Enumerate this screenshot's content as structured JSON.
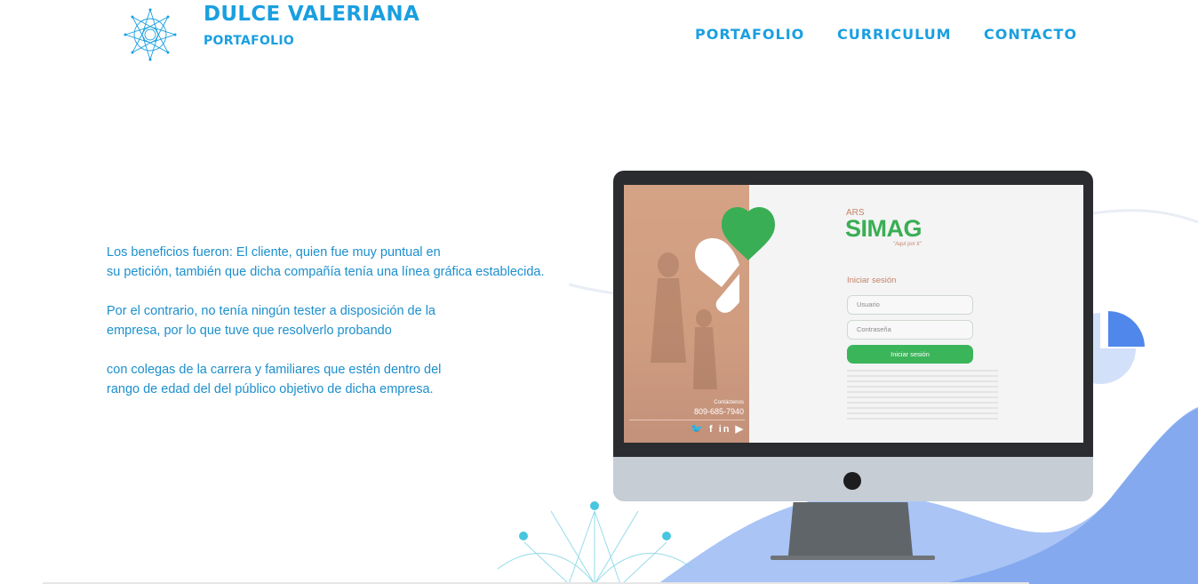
{
  "header": {
    "title": "DULCE VALERIANA",
    "subtitle": "PORTAFOLIO",
    "logo_icon": "mandala-icon"
  },
  "nav": {
    "items": [
      {
        "label": "PORTAFOLIO"
      },
      {
        "label": "CURRICULUM"
      },
      {
        "label": "CONTACTO"
      }
    ]
  },
  "content": {
    "paragraph1_line1": "Los beneficios fueron: El cliente, quien fue muy puntual en",
    "paragraph1_line2": "su petición, también que dicha compañía tenía una línea gráfica establecida.",
    "paragraph2_line1": "Por el contrario, no tenía ningún tester a disposición de la",
    "paragraph2_line2": "empresa, por lo que tuve que resolverlo probando",
    "paragraph3_line1": "con colegas de la carrera y familiares que estén dentro del",
    "paragraph3_line2": "rango de edad del del público objetivo de dicha empresa."
  },
  "mockup": {
    "brand_small": "ARS",
    "brand_name": "SIMAG",
    "slogan": "\"Aquí por ti\"",
    "login_title": "Iniciar sesión",
    "user_placeholder": "Usuario",
    "password_placeholder": "Contraseña",
    "login_button": "Iniciar sesión",
    "contact_label": "Contáctenos",
    "contact_phone": "809-685-7940",
    "social_icons": "twitter-icon facebook-icon linkedin-icon youtube-icon",
    "social_text": "🐦 f in ▶"
  },
  "colors": {
    "accent": "#1a9fe0",
    "text": "#1c8fce",
    "green": "#3aae54",
    "peach": "#c5836a",
    "wave": "#8fb3f2"
  }
}
